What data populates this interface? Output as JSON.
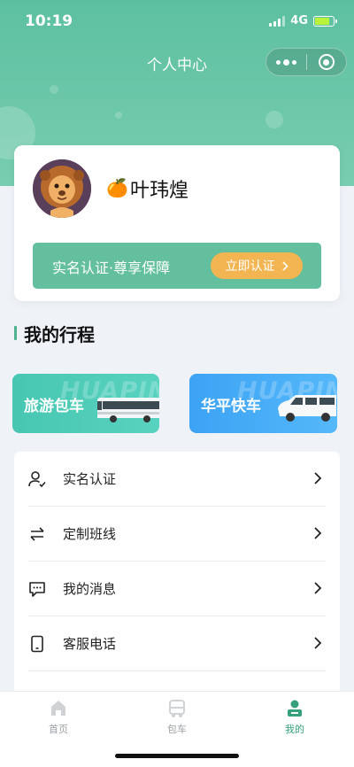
{
  "status_bar": {
    "time": "10:19",
    "network": "4G"
  },
  "header": {
    "title": "个人中心"
  },
  "profile": {
    "emoji": "🍊",
    "name": "叶玮煌",
    "verify_banner_text": "实名认证·尊享保障",
    "verify_button_label": "立即认证"
  },
  "trips": {
    "section_title": "我的行程",
    "cards": [
      {
        "label": "旅游包车",
        "watermark": "HUAPIN"
      },
      {
        "label": "华平快车",
        "watermark": "HUAPIN"
      }
    ]
  },
  "menu": {
    "items": [
      {
        "label": "实名认证",
        "icon": "user-check-icon"
      },
      {
        "label": "定制班线",
        "icon": "swap-arrows-icon"
      },
      {
        "label": "我的消息",
        "icon": "message-icon"
      },
      {
        "label": "客服电话",
        "icon": "phone-icon"
      }
    ]
  },
  "tabbar": {
    "tabs": [
      {
        "label": "首页",
        "icon": "home-icon",
        "active": false
      },
      {
        "label": "包车",
        "icon": "bus-icon",
        "active": false
      },
      {
        "label": "我的",
        "icon": "profile-icon",
        "active": true
      }
    ]
  },
  "colors": {
    "brand": "#5cc0a0",
    "banner": "#63bf9d",
    "verify_button": "#f2b552",
    "tour_card": "#47c7b2",
    "express_card": "#3ca3f4",
    "active_tab": "#34a07c"
  }
}
